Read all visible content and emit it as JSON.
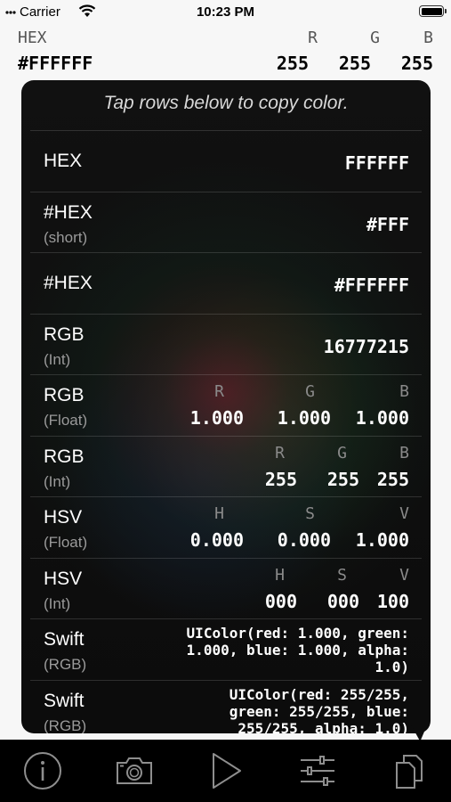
{
  "status_bar": {
    "carrier": "Carrier",
    "time": "10:23 PM"
  },
  "header": {
    "hex_label": "HEX",
    "hex_value": "#FFFFFF",
    "r_label": "R",
    "g_label": "G",
    "b_label": "B",
    "r_value": "255",
    "g_value": "255",
    "b_value": "255"
  },
  "popover": {
    "hint": "Tap rows below to copy color.",
    "rows": [
      {
        "title": "HEX",
        "value": "FFFFFF"
      },
      {
        "title": "#HEX",
        "subtitle": "(short)",
        "value": "#FFF"
      },
      {
        "title": "#HEX",
        "value": "#FFFFFF"
      },
      {
        "title": "RGB",
        "subtitle": "(Int)",
        "value": "16777215"
      },
      {
        "title": "RGB",
        "subtitle": "(Float)",
        "labels": [
          "R",
          "G",
          "B"
        ],
        "values": [
          "1.000",
          "1.000",
          "1.000"
        ]
      },
      {
        "title": "RGB",
        "subtitle": "(Int)",
        "labels": [
          "R",
          "G",
          "B"
        ],
        "values": [
          "255",
          "255",
          "255"
        ]
      },
      {
        "title": "HSV",
        "subtitle": "(Float)",
        "labels": [
          "H",
          "S",
          "V"
        ],
        "values": [
          "0.000",
          "0.000",
          "1.000"
        ]
      },
      {
        "title": "HSV",
        "subtitle": "(Int)",
        "labels": [
          "H",
          "S",
          "V"
        ],
        "values": [
          "000",
          "000",
          "100"
        ]
      },
      {
        "title": "Swift",
        "subtitle": "(RGB)",
        "code_lines": [
          "UIColor(red: 1.000, green:",
          "1.000, blue: 1.000, alpha:",
          "1.0)"
        ]
      },
      {
        "title": "Swift",
        "subtitle": "(RGB)",
        "code_lines": [
          "UIColor(red: 255/255,",
          "green: 255/255, blue:",
          "255/255, alpha: 1.0)"
        ]
      }
    ]
  },
  "tabbar": {
    "items": [
      {
        "icon": "info-icon"
      },
      {
        "icon": "camera-icon"
      },
      {
        "icon": "play-icon"
      },
      {
        "icon": "sliders-icon"
      },
      {
        "icon": "copy-icon"
      }
    ]
  },
  "colors": {
    "background": "#f7f7f7",
    "popover": "#0c0c0c",
    "tabbar": "#000000",
    "secondary_text": "#9a9a9a"
  }
}
